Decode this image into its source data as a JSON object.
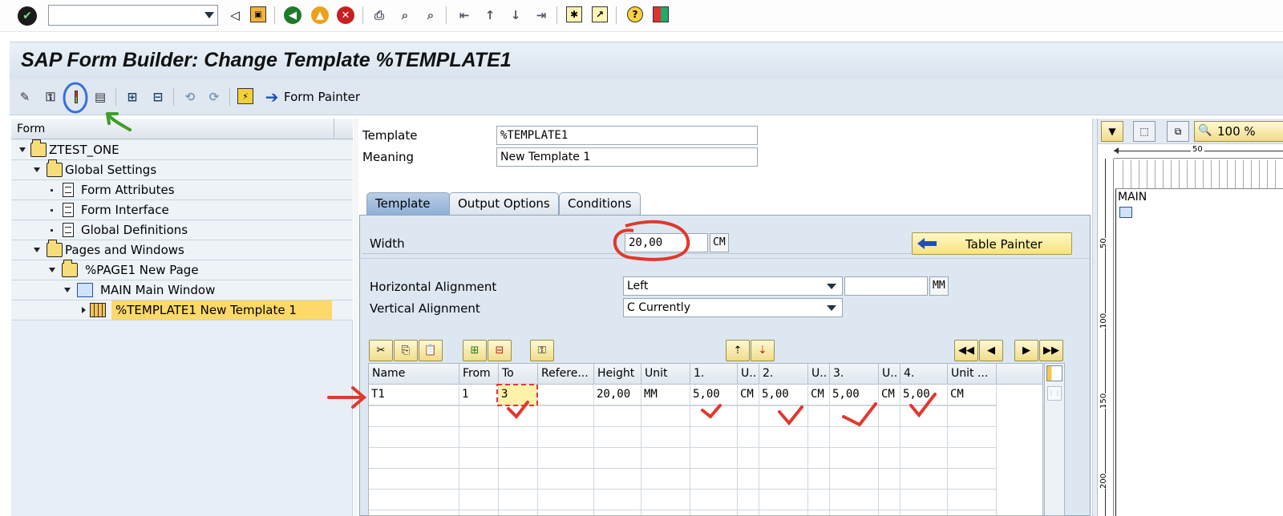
{
  "system_toolbar": {
    "command_field_value": "",
    "icons": [
      "enter-icon",
      "back-icon",
      "save-icon",
      "back-nav-icon",
      "exit-icon",
      "cancel-icon",
      "print-icon",
      "find-icon",
      "find-next-icon",
      "first-page-icon",
      "prev-page-icon",
      "next-page-icon",
      "last-page-icon",
      "new-session-icon",
      "shortcut-icon",
      "help-icon",
      "layout-icon"
    ]
  },
  "title": "SAP Form Builder: Change Template %TEMPLATE1",
  "app_toolbar": {
    "form_painter_label": "Form Painter"
  },
  "tree": {
    "header": "Form",
    "nodes": [
      {
        "label": "ZTEST_ONE"
      },
      {
        "label": "Global Settings"
      },
      {
        "label": "Form Attributes"
      },
      {
        "label": "Form Interface"
      },
      {
        "label": "Global Definitions"
      },
      {
        "label": "Pages and Windows"
      },
      {
        "label": "%PAGE1 New Page"
      },
      {
        "label": "MAIN Main Window"
      },
      {
        "label": "%TEMPLATE1 New Template 1"
      }
    ]
  },
  "header_fields": {
    "template_label": "Template",
    "template_value": "%TEMPLATE1",
    "meaning_label": "Meaning",
    "meaning_value": "New Template 1"
  },
  "tabs": [
    {
      "label": "Template",
      "active": true
    },
    {
      "label": "Output Options",
      "active": false
    },
    {
      "label": "Conditions",
      "active": false
    }
  ],
  "template_tab": {
    "width_label": "Width",
    "width_value": "20,00",
    "width_unit": "CM",
    "table_painter_label": "Table Painter",
    "h_align_label": "Horizontal Alignment",
    "h_align_value": "Left",
    "h_align_offset": "",
    "h_align_unit": "MM",
    "v_align_label": "Vertical Alignment",
    "v_align_value": "C Currently"
  },
  "line_table": {
    "columns": [
      "Name",
      "From",
      "To",
      "Refere...",
      "Height",
      "Unit",
      "1.",
      "U..",
      "2.",
      "U..",
      "3.",
      "U..",
      "4.",
      "Unit ..."
    ],
    "rows": [
      [
        "T1",
        "1",
        "3",
        "",
        "20,00",
        "MM",
        "5,00",
        "CM",
        "5,00",
        "CM",
        "5,00",
        "CM",
        "5,00",
        "CM"
      ]
    ]
  },
  "preview": {
    "zoom": "100 %",
    "ruler_h": "50",
    "ruler_v": [
      "50",
      "100",
      "150",
      "200"
    ],
    "window_label": "MAIN"
  },
  "colors": {
    "title_bg": "#dfe8f1",
    "active_tab": "#9fbcdd",
    "selected_node": "#fdd86a",
    "annotation_red": "#e0392d"
  }
}
